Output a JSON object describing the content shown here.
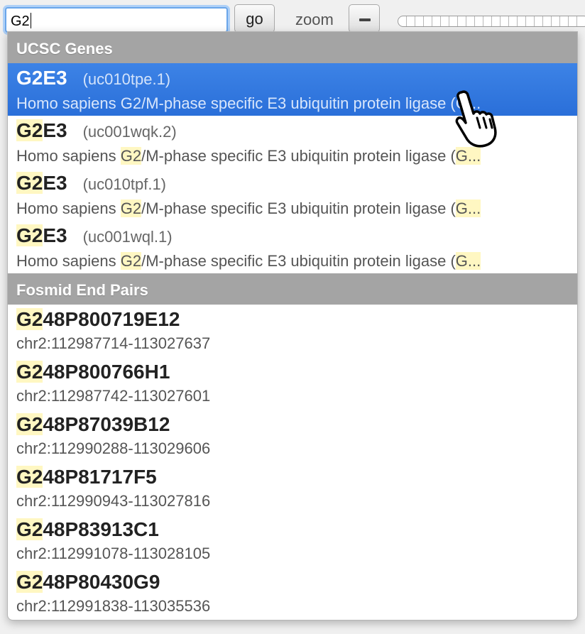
{
  "toolbar": {
    "search_value": "G2",
    "go_label": "go",
    "zoom_label": "zoom"
  },
  "dropdown": {
    "groups": [
      {
        "header": "UCSC Genes",
        "items": [
          {
            "hl": "G2",
            "rest": "E3",
            "sub": "(uc010tpe.1)",
            "desc_pre": "Homo sapiens G2/M-phase specific E3 ubiquitin protein ligase (G...",
            "desc_hl": "",
            "desc_post": "",
            "desc_hl2": "",
            "desc_tail": ""
          },
          {
            "hl": "G2",
            "rest": "E3",
            "sub": "(uc001wqk.2)",
            "desc_pre": "Homo sapiens ",
            "desc_hl": "G2",
            "desc_post": "/M-phase specific E3 ubiquitin protein ligase (",
            "desc_hl2": "G...",
            "desc_tail": ""
          },
          {
            "hl": "G2",
            "rest": "E3",
            "sub": "(uc010tpf.1)",
            "desc_pre": "Homo sapiens ",
            "desc_hl": "G2",
            "desc_post": "/M-phase specific E3 ubiquitin protein ligase (",
            "desc_hl2": "G...",
            "desc_tail": ""
          },
          {
            "hl": "G2",
            "rest": "E3",
            "sub": "(uc001wql.1)",
            "desc_pre": "Homo sapiens ",
            "desc_hl": "G2",
            "desc_post": "/M-phase specific E3 ubiquitin protein ligase (",
            "desc_hl2": "G...",
            "desc_tail": ""
          }
        ]
      },
      {
        "header": "Fosmid End Pairs",
        "items": [
          {
            "hl": "G2",
            "rest": "48P800719E12",
            "loc": "chr2:112987714-113027637"
          },
          {
            "hl": "G2",
            "rest": "48P800766H1",
            "loc": "chr2:112987742-113027601"
          },
          {
            "hl": "G2",
            "rest": "48P87039B12",
            "loc": "chr2:112990288-113029606"
          },
          {
            "hl": "G2",
            "rest": "48P81717F5",
            "loc": "chr2:112990943-113027816"
          },
          {
            "hl": "G2",
            "rest": "48P83913C1",
            "loc": "chr2:112991078-113028105"
          },
          {
            "hl": "G2",
            "rest": "48P80430G9",
            "loc": "chr2:112991838-113035536"
          }
        ]
      }
    ]
  },
  "icons": {
    "cursor": "hand-pointer-icon",
    "zoom_out": "minus-icon"
  }
}
